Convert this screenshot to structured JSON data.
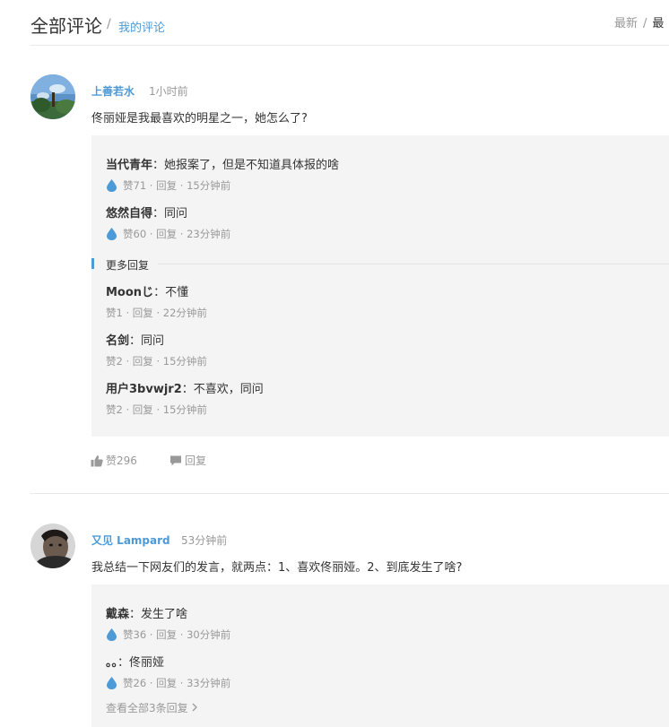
{
  "header": {
    "title": "全部评论",
    "slash": "/",
    "mine_link": "我的评论",
    "sort_latest": "最新",
    "sort_sep": "/",
    "sort_other": "最"
  },
  "comments": [
    {
      "user": "上善若水",
      "time": "1小时前",
      "text": "佟丽娅是我最喜欢的明星之一，她怎么了?",
      "replies": [
        {
          "user": "当代青年",
          "sep": "：",
          "text": "她报案了，但是不知道具体报的啥",
          "meta": "赞71 · 回复 · 15分钟前"
        },
        {
          "user": "悠然自得",
          "sep": "：",
          "text": "同问",
          "meta": "赞60 · 回复 · 23分钟前"
        }
      ],
      "more_label": "更多回复",
      "more_replies": [
        {
          "user": "Moonじ",
          "sep": "：",
          "text": "不懂",
          "meta": "赞1 · 回复 · 22分钟前"
        },
        {
          "user": "名剑",
          "sep": "：",
          "text": "同问",
          "meta": "赞2 · 回复 · 15分钟前"
        },
        {
          "user": "用户3bvwjr2",
          "sep": "：",
          "text": "不喜欢，同问",
          "meta": "赞2 · 回复 · 15分钟前"
        }
      ],
      "like_label": "赞296",
      "reply_label": "回复"
    },
    {
      "user": "又见  Lampard",
      "time": "53分钟前",
      "text": "我总结一下网友们的发言，就两点：1、喜欢佟丽娅。2、到底发生了啥?",
      "replies": [
        {
          "user": "戴森",
          "sep": "：",
          "text": "发生了啥",
          "meta": "赞36 · 回复 · 30分钟前"
        },
        {
          "user": "。。",
          "sep": "：",
          "text": "佟丽娅",
          "meta": "赞26 · 回复 · 33分钟前"
        }
      ],
      "view_all": "查看全部3条回复"
    }
  ],
  "colors": {
    "accent": "#4e9ad6",
    "muted": "#999999",
    "reply_bg": "#f4f4f4"
  }
}
